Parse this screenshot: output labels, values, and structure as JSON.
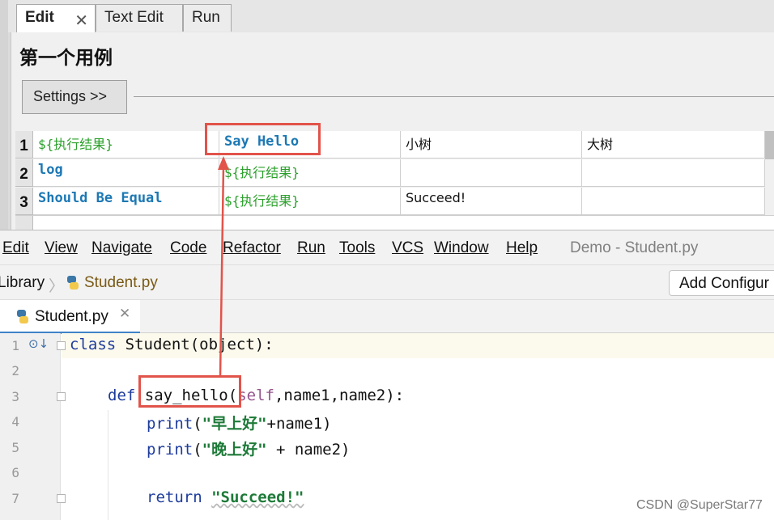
{
  "ride": {
    "tabs": [
      {
        "label": "Edit"
      },
      {
        "label": "Text Edit"
      },
      {
        "label": "Run"
      }
    ],
    "test_title": "第一个用例",
    "settings_label": "Settings >>",
    "rows": [
      {
        "num": "1",
        "cells": [
          "${执行结果}",
          "Say Hello",
          "小树",
          "大树"
        ]
      },
      {
        "num": "2",
        "cells": [
          "log",
          "${执行结果}",
          "",
          ""
        ]
      },
      {
        "num": "3",
        "cells": [
          "Should Be Equal",
          "${执行结果}",
          "Succeed!",
          ""
        ]
      }
    ]
  },
  "ide": {
    "menu": [
      "Edit",
      "View",
      "Navigate",
      "Code",
      "Refactor",
      "Run",
      "Tools",
      "VCS",
      "Window",
      "Help"
    ],
    "window_title": "Demo - Student.py",
    "breadcrumb": [
      "Library",
      "Student.py"
    ],
    "add_config_label": "Add Configur",
    "editor_tab": "Student.py",
    "line_numbers": [
      "1",
      "2",
      "3",
      "4",
      "5",
      "6",
      "7"
    ],
    "code": {
      "l1_kw": "class",
      "l1_rest": " Student(object):",
      "l3_kw": "def",
      "l3_fn": "say_hello",
      "l3_paren": "(",
      "l3_self": "self",
      "l3_rest": ",name1,name2):",
      "l4_fn": "print",
      "l4_open": "(",
      "l4_str": "\"早上好\"",
      "l4_rest": "+name1)",
      "l5_fn": "print",
      "l5_open": "(",
      "l5_str": "\"晚上好\"",
      "l5_rest": " + name2)",
      "l7_kw": "return",
      "l7_str": "\"Succeed!\""
    }
  },
  "watermark": "CSDN @SuperStar77",
  "colors": {
    "annotation": "#e2534a",
    "keyword": "#1c78b4",
    "variable": "#2aa02a"
  }
}
